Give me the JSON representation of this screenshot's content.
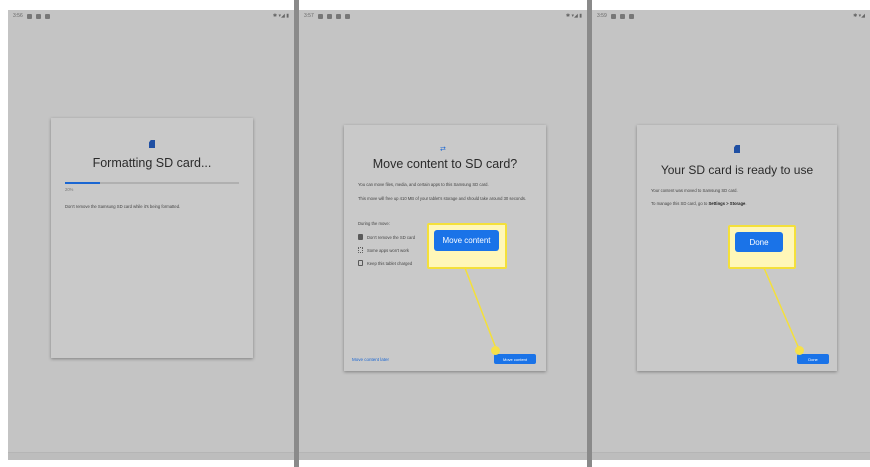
{
  "screens": [
    {
      "status_time": "3:56",
      "status_right": "✱ ▾◢ ▮",
      "title": "Formatting SD card...",
      "progress_text": "20%",
      "progress_fraction": 0.2,
      "body": "Don't remove the Samsung SD card while it's being formatted."
    },
    {
      "status_time": "3:57",
      "status_right": "✱ ▾◢ ▮",
      "title": "Move content to SD card?",
      "para1": "You can move files, media, and certain apps to this Samsung SD card.",
      "para2": "This move will free up 410 MB of your tablet's storage and should take around 30 seconds.",
      "during_label": "During the move:",
      "list": [
        "Don't remove the SD card",
        "Some apps won't work",
        "Keep this tablet charged"
      ],
      "callout_button": "Move content",
      "move_later": "Move content later",
      "bottom_button": "Move content"
    },
    {
      "status_time": "3:59",
      "status_right": "✱ ▾◢",
      "title": "Your SD card is ready to use",
      "para1": "Your content was moved to Samsung SD card.",
      "para2_prefix": "To manage this SD card, go to ",
      "para2_bold": "Settings > Storage",
      "para2_suffix": ".",
      "callout_button": "Done",
      "bottom_button": "Done"
    }
  ],
  "colors": {
    "accent": "#1a73e8",
    "highlight": "#f4e03a",
    "panel_bg": "#c4c4c4",
    "divider": "#8a8a8a"
  }
}
